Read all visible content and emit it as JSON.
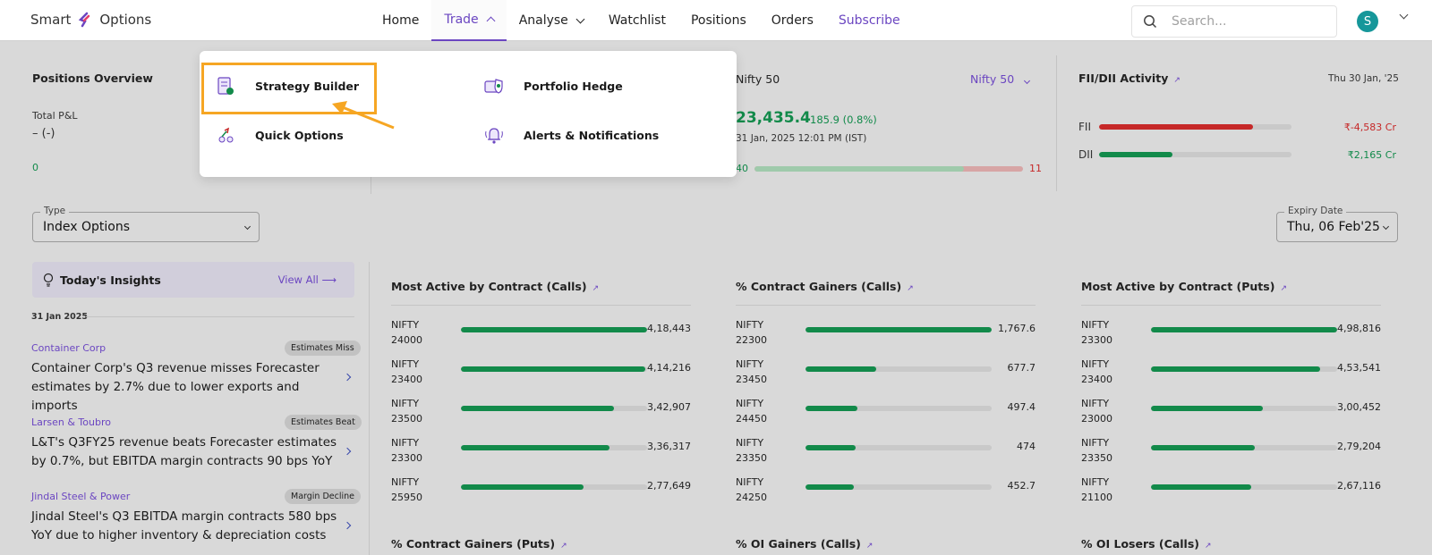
{
  "header": {
    "logo": {
      "left": "Smart",
      "right": "Options"
    },
    "nav": [
      {
        "label": "Home"
      },
      {
        "label": "Trade"
      },
      {
        "label": "Analyse"
      },
      {
        "label": "Watchlist"
      },
      {
        "label": "Positions"
      },
      {
        "label": "Orders"
      },
      {
        "label": "Subscribe"
      }
    ],
    "search_placeholder": "Search...",
    "avatar_initial": "S"
  },
  "positions": {
    "title": "Positions Overview",
    "total_label": "Total P&L",
    "total_value": "– (-)",
    "count": "0"
  },
  "nifty": {
    "title": "Nifty 50",
    "selector": "Nifty 50",
    "price": "23,435.4",
    "change": "185.9 (0.8%)",
    "time": "31 Jan, 2025 12:01 PM (IST)",
    "adv": "40",
    "dec": "11",
    "adv_fraction": 0.78
  },
  "fii": {
    "title": "FII/DII Activity",
    "date": "Thu 30 Jan, '25",
    "rows": [
      {
        "label": "FII",
        "value": "₹-4,583 Cr",
        "fraction": 0.8
      },
      {
        "label": "DII",
        "value": "₹2,165 Cr",
        "fraction": 0.38
      }
    ]
  },
  "filters": {
    "type_label": "Type",
    "type_value": "Index Options",
    "expiry_label": "Expiry Date",
    "expiry_value": "Thu, 06 Feb'25"
  },
  "insights": {
    "title": "Today's Insights",
    "view_all": "View All",
    "date": "31 Jan 2025",
    "items": [
      {
        "company": "Container Corp",
        "badge": "Estimates Miss",
        "headline": "Container Corp's Q3 revenue misses Forecaster estimates by 2.7% due to lower exports and imports"
      },
      {
        "company": "Larsen & Toubro",
        "badge": "Estimates Beat",
        "headline": "L&T's Q3FY25 revenue beats Forecaster estimates by 0.7%, but EBITDA margin contracts 90 bps YoY"
      },
      {
        "company": "Jindal Steel & Power",
        "badge": "Margin Decline",
        "headline": "Jindal Steel's Q3 EBITDA margin contracts 580 bps YoY due to higher inventory & depreciation costs"
      }
    ]
  },
  "lists": [
    {
      "title": "Most Active by Contract (Calls)",
      "items": [
        {
          "name": "NIFTY",
          "strike": "24000",
          "value": "4,18,443",
          "fraction": 1.0
        },
        {
          "name": "NIFTY",
          "strike": "23400",
          "value": "4,14,216",
          "fraction": 0.99
        },
        {
          "name": "NIFTY",
          "strike": "23500",
          "value": "3,42,907",
          "fraction": 0.82
        },
        {
          "name": "NIFTY",
          "strike": "23300",
          "value": "3,36,317",
          "fraction": 0.8
        },
        {
          "name": "NIFTY",
          "strike": "25950",
          "value": "2,77,649",
          "fraction": 0.66
        }
      ]
    },
    {
      "title": "% Contract Gainers (Calls)",
      "items": [
        {
          "name": "NIFTY",
          "strike": "22300",
          "value": "1,767.6",
          "fraction": 1.0
        },
        {
          "name": "NIFTY",
          "strike": "23450",
          "value": "677.7",
          "fraction": 0.38
        },
        {
          "name": "NIFTY",
          "strike": "24450",
          "value": "497.4",
          "fraction": 0.28
        },
        {
          "name": "NIFTY",
          "strike": "23350",
          "value": "474",
          "fraction": 0.27
        },
        {
          "name": "NIFTY",
          "strike": "24250",
          "value": "452.7",
          "fraction": 0.26
        }
      ]
    },
    {
      "title": "Most Active by Contract (Puts)",
      "items": [
        {
          "name": "NIFTY",
          "strike": "23300",
          "value": "4,98,816",
          "fraction": 1.0
        },
        {
          "name": "NIFTY",
          "strike": "23400",
          "value": "4,53,541",
          "fraction": 0.91
        },
        {
          "name": "NIFTY",
          "strike": "23000",
          "value": "3,00,452",
          "fraction": 0.6
        },
        {
          "name": "NIFTY",
          "strike": "23350",
          "value": "2,79,204",
          "fraction": 0.56
        },
        {
          "name": "NIFTY",
          "strike": "21100",
          "value": "2,67,116",
          "fraction": 0.54
        }
      ]
    }
  ],
  "bottom_titles": [
    "% Contract Gainers (Puts)",
    "% OI Gainers (Calls)",
    "% OI Losers (Calls)"
  ],
  "dropdown": {
    "items": [
      {
        "label": "Strategy Builder",
        "icon": "strategy-builder-icon"
      },
      {
        "label": "Portfolio Hedge",
        "icon": "portfolio-hedge-icon"
      },
      {
        "label": "Quick Options",
        "icon": "quick-options-icon"
      },
      {
        "label": "Alerts & Notifications",
        "icon": "alerts-icon"
      }
    ]
  },
  "colors": {
    "accent": "#6b46c1",
    "green": "#128a4a",
    "red": "#c62828",
    "highlight": "#f6a623"
  }
}
